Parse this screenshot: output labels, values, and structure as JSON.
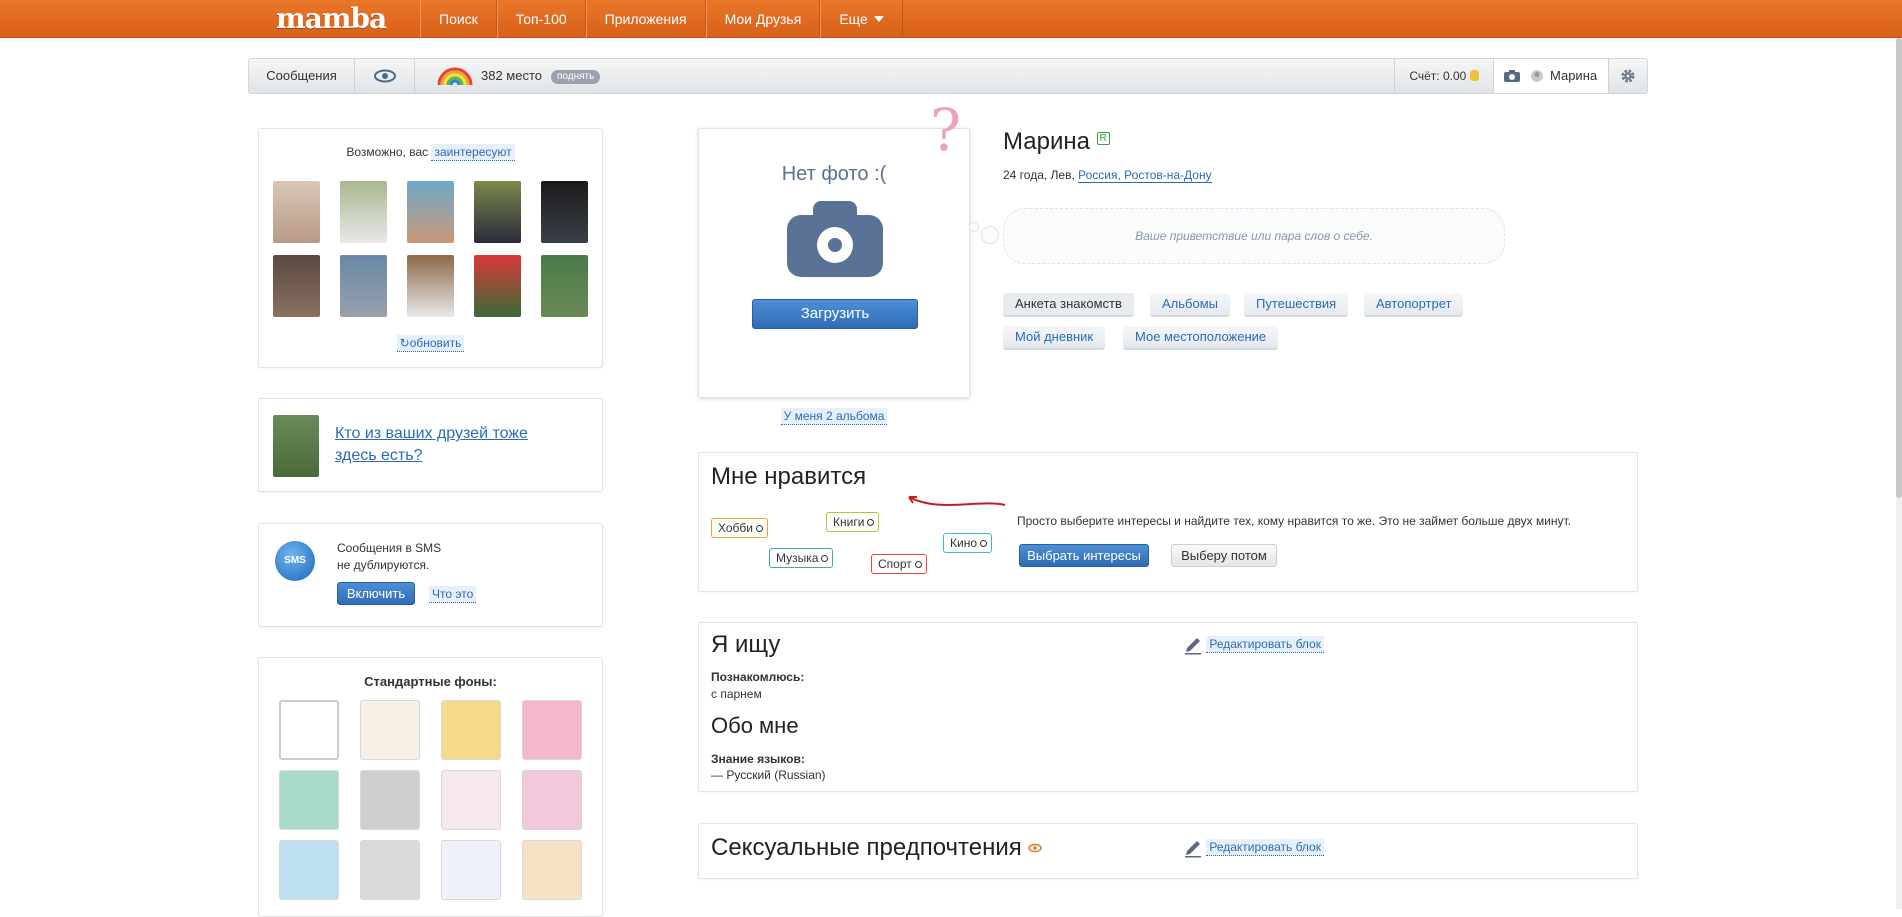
{
  "header": {
    "logo": "mamba",
    "nav": [
      "Поиск",
      "Топ-100",
      "Приложения",
      "Мои Друзья",
      "Еще"
    ]
  },
  "subbar": {
    "messages": "Сообщения",
    "rank_text": "382 место",
    "raise_label": "поднять",
    "balance": "Счёт: 0.00",
    "user_name": "Марина"
  },
  "suggest": {
    "prefix": "Возможно, вас",
    "link": "заинтересуют",
    "refresh": "обновить"
  },
  "friends_panel": {
    "text": "Кто из ваших друзей тоже здесь есть?"
  },
  "sms_panel": {
    "line1": "Сообщения в SMS",
    "line2": "не дублируются.",
    "enable": "Включить",
    "what": "Что это"
  },
  "backgrounds": {
    "title": "Стандартные фоны:"
  },
  "photo": {
    "no_photo": "Нет фото :(",
    "upload": "Загрузить",
    "albums_link": "У меня 2 альбома"
  },
  "profile": {
    "name": "Марина",
    "badge": "R",
    "meta": "24 года, Лев,",
    "location": "Россия, Ростов-на-Дону",
    "greeting_placeholder": "Ваше приветствие или пара слов о себе.",
    "tabs": [
      "Анкета знакомств",
      "Альбомы",
      "Путешествия",
      "Автопортрет",
      "Мой дневник",
      "Мое местоположение"
    ]
  },
  "likes": {
    "title": "Мне нравится",
    "tags": [
      "Хобби",
      "Книги",
      "Кино",
      "Музыка",
      "Спорт"
    ],
    "text": "Просто выберите интересы и найдите тех, кому нравится то же. Это не займет больше двух минут.",
    "choose": "Выбрать интересы",
    "later": "Выберу потом"
  },
  "seeking": {
    "title": "Я ищу",
    "edit": "Редактировать блок",
    "meet_label": "Познакомлюсь:",
    "meet_value": "с парнем",
    "about_title": "Обо мне",
    "lang_label": "Знание языков:",
    "lang_value": "— Русский (Russian)"
  },
  "sexual": {
    "title": "Сексуальные предпочтения",
    "edit": "Редактировать блок"
  }
}
